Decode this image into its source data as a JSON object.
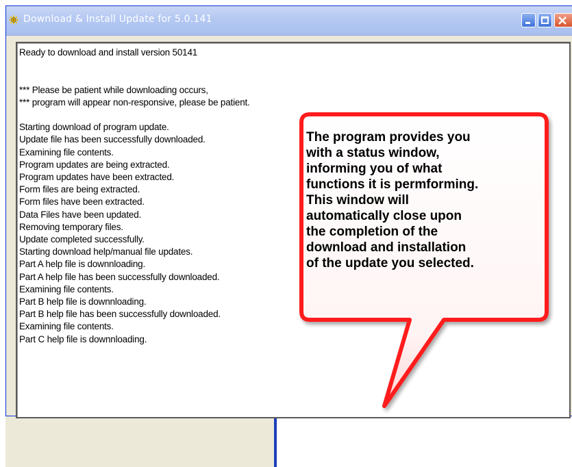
{
  "window": {
    "title": "Download & Install Update for 5.0.141"
  },
  "log": {
    "lines": [
      "Ready to download and install version 50141",
      "",
      "",
      "*** Please be patient while downloading occurs,",
      "*** program will appear non-responsive, please be patient.",
      "",
      "Starting download of program update.",
      "Update file has been successfully downloaded.",
      "Examining file contents.",
      "Program updates are being extracted.",
      "Program updates have been extracted.",
      "Form files are being extracted.",
      "Form files have been extracted.",
      "Data Files have been updated.",
      "Removing temporary files.",
      "Update completed successfully.",
      "Starting download help/manual file updates.",
      "Part A help file is downnloading.",
      "Part A help file has been successfully downloaded.",
      "Examining file contents.",
      "Part B help file is downnloading.",
      "Part B help file has been successfully downloaded.",
      "Examining file contents.",
      "Part C help file is downnloading."
    ]
  },
  "callout": {
    "text_lines": [
      "The program provides you",
      "with a status window,",
      "informing you of what",
      "functions it is permforming.",
      "This window will",
      "automatically close upon",
      "the completion of the",
      "download and installation",
      "of the update you selected."
    ],
    "fill_color": "#ff1a1a",
    "inner_color": "#ffffff"
  },
  "icons": {
    "title_icon": "gear-icon",
    "minimize": "minimize-icon",
    "maximize": "maximize-icon",
    "close": "close-icon"
  }
}
